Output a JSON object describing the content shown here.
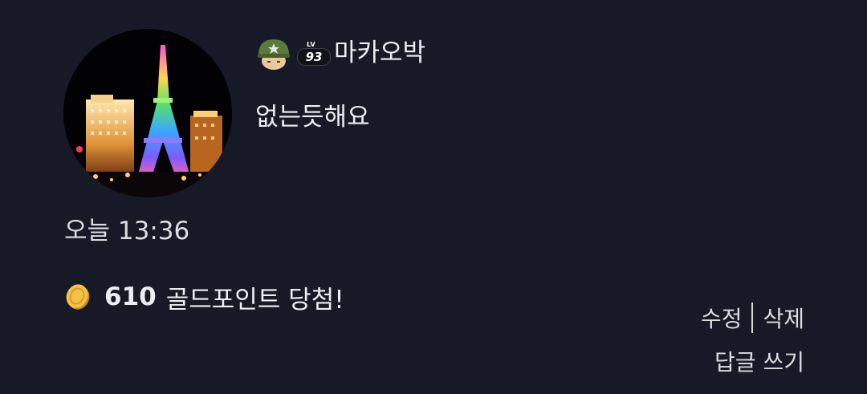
{
  "comment": {
    "username": "마카오박",
    "level": {
      "label": "LV",
      "value": "93"
    },
    "text": "없는듯해요",
    "timestamp": "오늘 13:36",
    "reward": {
      "points": "610",
      "text": "골드포인트 당첨!"
    },
    "actions": {
      "edit": "수정",
      "delete": "삭제",
      "reply": "답글 쓰기"
    },
    "icons": {
      "avatar": "profile-photo-eiffel-tower-night",
      "rank": "soldier-helmet-icon",
      "coin": "gold-coin-icon"
    }
  },
  "colors": {
    "background": "#171a26",
    "text": "#eceef2",
    "coin": "#e8b23a"
  }
}
